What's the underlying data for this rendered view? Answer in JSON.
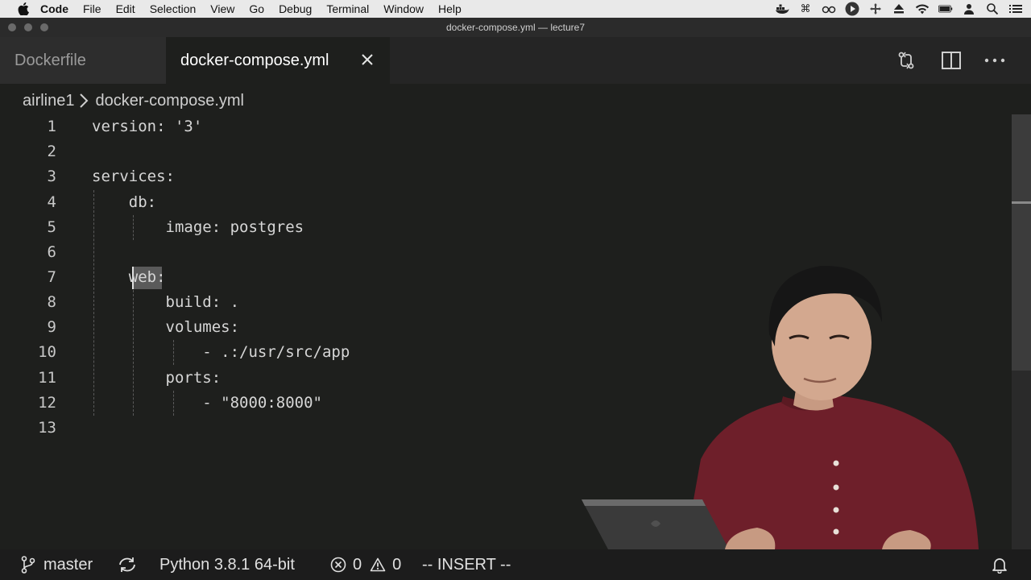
{
  "menubar": {
    "apple_icon": "apple-logo",
    "items": [
      "Code",
      "File",
      "Edit",
      "Selection",
      "View",
      "Go",
      "Debug",
      "Terminal",
      "Window",
      "Help"
    ]
  },
  "window": {
    "title": "docker-compose.yml — lecture7"
  },
  "tabs": [
    {
      "label": "Dockerfile",
      "active": false
    },
    {
      "label": "docker-compose.yml",
      "active": true
    }
  ],
  "breadcrumb": [
    "airline1",
    "docker-compose.yml"
  ],
  "editor": {
    "lines": [
      {
        "n": "1",
        "text": "version: '3'"
      },
      {
        "n": "2",
        "text": ""
      },
      {
        "n": "3",
        "text": "services:"
      },
      {
        "n": "4",
        "text": "    db:"
      },
      {
        "n": "5",
        "text": "        image: postgres"
      },
      {
        "n": "6",
        "text": ""
      },
      {
        "n": "7",
        "text": "    web:"
      },
      {
        "n": "8",
        "text": "        build: ."
      },
      {
        "n": "9",
        "text": "        volumes:"
      },
      {
        "n": "10",
        "text": "            - .:/usr/src/app"
      },
      {
        "n": "11",
        "text": "        ports:"
      },
      {
        "n": "12",
        "text": "            - \"8000:8000\""
      },
      {
        "n": "13",
        "text": ""
      }
    ]
  },
  "statusbar": {
    "branch": "master",
    "python": "Python 3.8.1 64-bit",
    "errors": "0",
    "warnings": "0",
    "mode": "-- INSERT --"
  },
  "colors": {
    "editor_bg": "#1e1f1d",
    "menubar_bg": "#e9e9e9",
    "statusbar_bg": "#1c1c1c"
  }
}
